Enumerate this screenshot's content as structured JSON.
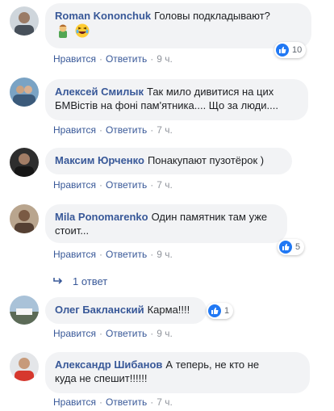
{
  "comments": [
    {
      "author": "Roman Kononchuk",
      "text": "Головы подкладывают?",
      "emojis": [
        "man-emoji",
        "laughing-emoji"
      ],
      "like_label": "Нравится",
      "reply_label": "Ответить",
      "time": "9 ч.",
      "reactions": "10"
    },
    {
      "author": "Алексей Смилык",
      "text_line1": "Так мило дивитися на цих",
      "text_line2": "БМВістів на фоні пам'ятника.... Що за люди....",
      "like_label": "Нравится",
      "reply_label": "Ответить",
      "time": "7 ч."
    },
    {
      "author": "Максим Юрченко",
      "text": "Понакупают пузотёрок )",
      "like_label": "Нравится",
      "reply_label": "Ответить",
      "time": "7 ч."
    },
    {
      "author": "Mila Ponomarenko",
      "text_line1": "Один памятник там уже",
      "text_line2": "стоит...",
      "like_label": "Нравится",
      "reply_label": "Ответить",
      "time": "9 ч.",
      "reactions": "5",
      "replies_label": "1 ответ"
    },
    {
      "author": "Олег Бакланский",
      "text": "Карма!!!!",
      "like_label": "Нравится",
      "reply_label": "Ответить",
      "time": "9 ч.",
      "reactions": "1"
    },
    {
      "author": "Александр Шибанов",
      "text_line1": "А теперь, не кто не",
      "text_line2": "куда не спешит!!!!!!",
      "like_label": "Нравится",
      "reply_label": "Ответить",
      "time": "7 ч."
    }
  ],
  "colors": {
    "link": "#385898",
    "bubble": "#f2f3f5",
    "meta": "#90949c",
    "like_blue": "#2078f4"
  }
}
